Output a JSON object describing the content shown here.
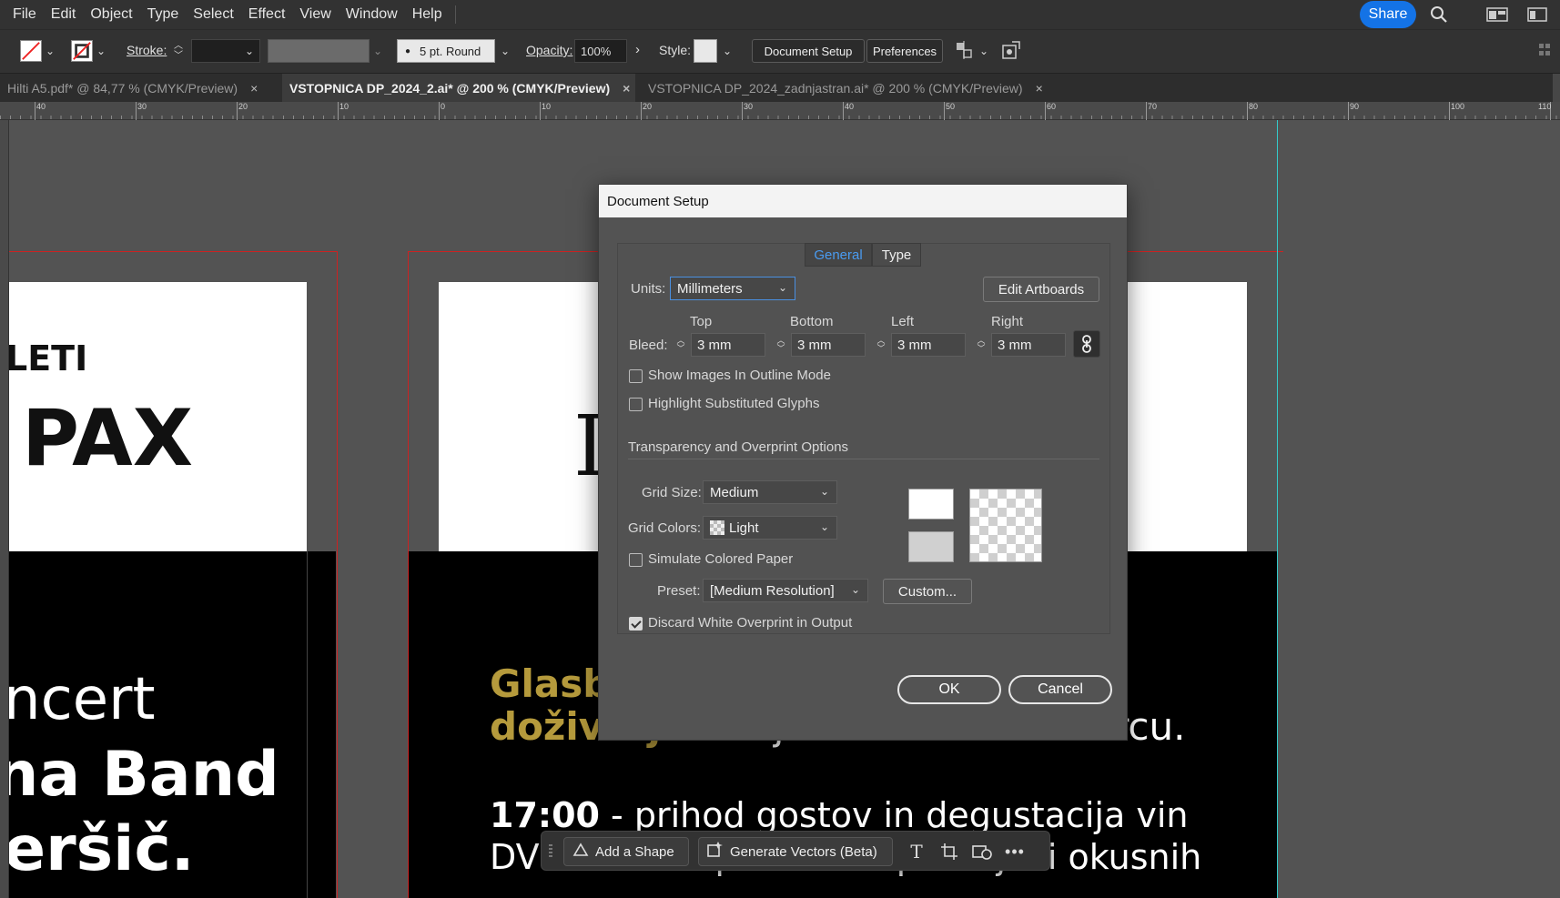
{
  "menu": [
    "File",
    "Edit",
    "Object",
    "Type",
    "Select",
    "Effect",
    "View",
    "Window",
    "Help"
  ],
  "share_label": "Share",
  "control": {
    "stroke_label": "Stroke:",
    "brush_value": "5 pt. Round",
    "opacity_label": "Opacity:",
    "opacity_value": "100%",
    "style_label": "Style:",
    "document_setup_button": "Document Setup",
    "preferences_button": "Preferences"
  },
  "tabs": [
    {
      "label": "Hilti A5.pdf* @ 84,77 % (CMYK/Preview)",
      "close": "×",
      "active": false
    },
    {
      "label": "VSTOPNICA DP_2024_2.ai* @ 200 % (CMYK/Preview)",
      "close": "×",
      "active": true
    },
    {
      "label": "VSTOPNICA DP_2024_zadnjastran.ai* @ 200 % (CMYK/Preview)",
      "close": "×",
      "active": false
    }
  ],
  "ruler": [
    "40",
    "30",
    "20",
    "10",
    "0",
    "10",
    "20",
    "30",
    "40",
    "50",
    "60",
    "70",
    "80",
    "90",
    "100",
    "110"
  ],
  "artwork": {
    "left_top_small": "LETI",
    "left_top_big": "PAX",
    "left_line1": "ncert",
    "left_line2": "na Band",
    "left_line3": "eršič.",
    "right_big_letter": "I",
    "right_gold1": "Glasb",
    "right_gold2": "doživetjem",
    "right_white_after": "v jarenninskem dvorcu.",
    "right_time": "17:00",
    "right_time_rest": " - prihod gostov in degustacija vin",
    "right_line_next": "DVERI PAX v parku ob spremljavi okusnih"
  },
  "dialog": {
    "title": "Document Setup",
    "tab_general": "General",
    "tab_type": "Type",
    "units_label": "Units:",
    "units_value": "Millimeters",
    "edit_artboards": "Edit Artboards",
    "bleed_label": "Bleed:",
    "bleed_top_label": "Top",
    "bleed_bottom_label": "Bottom",
    "bleed_left_label": "Left",
    "bleed_right_label": "Right",
    "bleed_top": "3 mm",
    "bleed_bottom": "3 mm",
    "bleed_left": "3 mm",
    "bleed_right": "3 mm",
    "show_images_outline": "Show Images In Outline Mode",
    "show_images_outline_checked": false,
    "highlight_glyphs": "Highlight Substituted Glyphs",
    "highlight_glyphs_checked": false,
    "transparency_section": "Transparency and Overprint Options",
    "grid_size_label": "Grid Size:",
    "grid_size_value": "Medium",
    "grid_colors_label": "Grid Colors:",
    "grid_colors_value": "Light",
    "simulate_paper": "Simulate Colored Paper",
    "simulate_paper_checked": false,
    "preset_label": "Preset:",
    "preset_value": "[Medium Resolution]",
    "custom_button": "Custom...",
    "discard_white": "Discard White Overprint in Output",
    "discard_white_checked": true,
    "ok_button": "OK",
    "cancel_button": "Cancel"
  },
  "taskbar": {
    "add_shape": "Add a Shape",
    "generate_vectors": "Generate Vectors (Beta)"
  },
  "colors": {
    "accent": "#1473e6",
    "gold_text": "#b59a3c",
    "bleed_line": "#cc2222",
    "guide": "#33cccc"
  }
}
